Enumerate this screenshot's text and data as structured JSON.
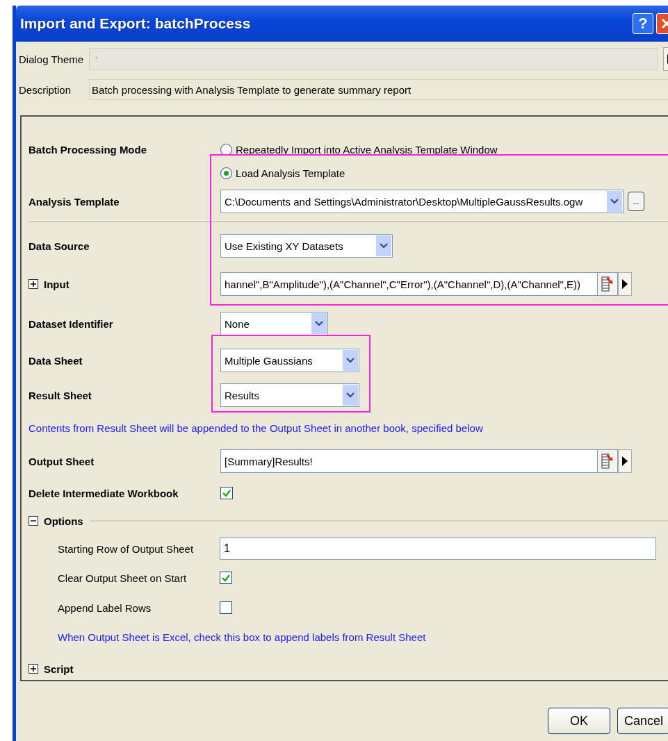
{
  "window": {
    "title": "Import and Export: batchProcess",
    "help": "?"
  },
  "dialog_theme": {
    "label": "Dialog Theme",
    "placeholder": "*"
  },
  "description": {
    "label": "Description",
    "value": "Batch processing with Analysis Template to generate summary report"
  },
  "rows": [
    {
      "kind": "radio",
      "label": "Batch Processing Mode",
      "option": "Repeatedly Import into Active Analysis Template Window",
      "selected": false
    },
    {
      "kind": "radio",
      "option": "Load Analysis Template",
      "selected": true
    },
    {
      "kind": "combo",
      "label": "Analysis Template",
      "value": "C:\\Documents and Settings\\Administrator\\Desktop\\MultipleGaussResults.ogw",
      "browse": "..."
    },
    {
      "kind": "divider"
    },
    {
      "kind": "combo",
      "label": "Data Source",
      "value": "Use Existing XY Datasets"
    },
    {
      "kind": "picker",
      "label": "Input",
      "expanded": false,
      "value": "hannel\",B\"Amplitude\"),(A\"Channel\",C\"Error\"),(A\"Channel\",D),(A\"Channel\",E))"
    },
    {
      "kind": "combo",
      "label": "Dataset Identifier",
      "value": "None"
    },
    {
      "kind": "combo",
      "label": "Data Sheet",
      "value": "Multiple Gaussians"
    },
    {
      "kind": "combo",
      "label": "Result Sheet",
      "value": "Results"
    },
    {
      "kind": "note",
      "text": "Contents from Result Sheet will be appended to the Output Sheet in another book, specified below"
    },
    {
      "kind": "picker",
      "label": "Output Sheet",
      "value": "[Summary]Results!"
    },
    {
      "kind": "checkbox",
      "label": "Delete Intermediate Workbook",
      "checked": true
    },
    {
      "kind": "section",
      "label": "Options",
      "expanded": true,
      "children": [
        {
          "kind": "text",
          "label": "Starting Row of Output Sheet",
          "value": "1"
        },
        {
          "kind": "checkbox",
          "label": "Clear Output Sheet on Start",
          "checked": true
        },
        {
          "kind": "checkbox",
          "label": "Append Label Rows",
          "checked": false
        },
        {
          "kind": "note",
          "text": "When Output Sheet is Excel, check this box to append labels from Result Sheet"
        }
      ]
    },
    {
      "kind": "section",
      "label": "Script",
      "expanded": false
    }
  ],
  "buttons": [
    "OK",
    "Cancel"
  ]
}
